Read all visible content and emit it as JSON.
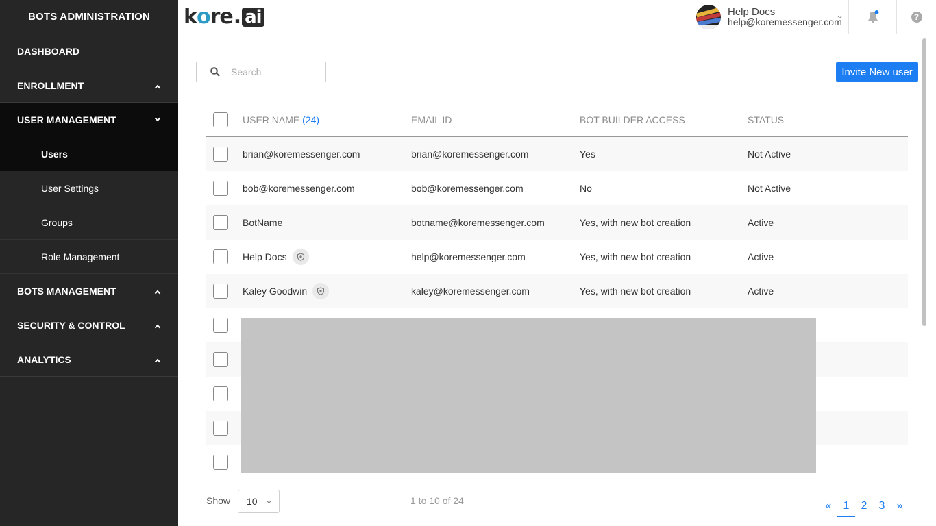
{
  "sidebar": {
    "title": "BOTS ADMINISTRATION",
    "items": [
      {
        "label": "DASHBOARD"
      },
      {
        "label": "ENROLLMENT"
      },
      {
        "label": "USER MANAGEMENT"
      },
      {
        "label": "BOTS MANAGEMENT"
      },
      {
        "label": "SECURITY & CONTROL"
      },
      {
        "label": "ANALYTICS"
      }
    ],
    "sub_items": [
      {
        "label": "Users"
      },
      {
        "label": "User Settings"
      },
      {
        "label": "Groups"
      },
      {
        "label": "Role Management"
      }
    ]
  },
  "header": {
    "logo": {
      "k": "k",
      "o": "o",
      "re": "re",
      "dot": ".",
      "ai": "ai"
    },
    "user_name": "Help Docs",
    "user_email": "help@koremessenger.com",
    "help_symbol": "?"
  },
  "search": {
    "placeholder": "Search"
  },
  "invite_label": "Invite New user",
  "table": {
    "headers": {
      "user_name": "USER NAME",
      "user_count": "(24)",
      "email": "EMAIL ID",
      "access": "BOT BUILDER ACCESS",
      "status": "STATUS"
    },
    "rows": [
      {
        "name": "brian@koremessenger.com",
        "email": "brian@koremessenger.com",
        "access": "Yes",
        "status": "Not Active"
      },
      {
        "name": "bob@koremessenger.com",
        "email": "bob@koremessenger.com",
        "access": "No",
        "status": "Not Active"
      },
      {
        "name": "BotName",
        "email": "botname@koremessenger.com",
        "access": "Yes, with new bot creation",
        "status": "Active"
      },
      {
        "name": "Help Docs",
        "email": "help@koremessenger.com",
        "access": "Yes, with new bot creation",
        "status": "Active"
      },
      {
        "name": "Kaley Goodwin",
        "email": "kaley@koremessenger.com",
        "access": "Yes, with new bot creation",
        "status": "Active"
      }
    ]
  },
  "footer": {
    "show_label": "Show",
    "page_size": "10",
    "range_text": "1 to 10 of 24",
    "first_symbol": "«",
    "last_symbol": "»",
    "pages": [
      "1",
      "2",
      "3"
    ]
  },
  "colors": {
    "sidebar_bg": "#262626",
    "sidebar_active": "#0c0c0c",
    "accent": "#1c7ef2",
    "logo_o": "#2e9bc4"
  }
}
